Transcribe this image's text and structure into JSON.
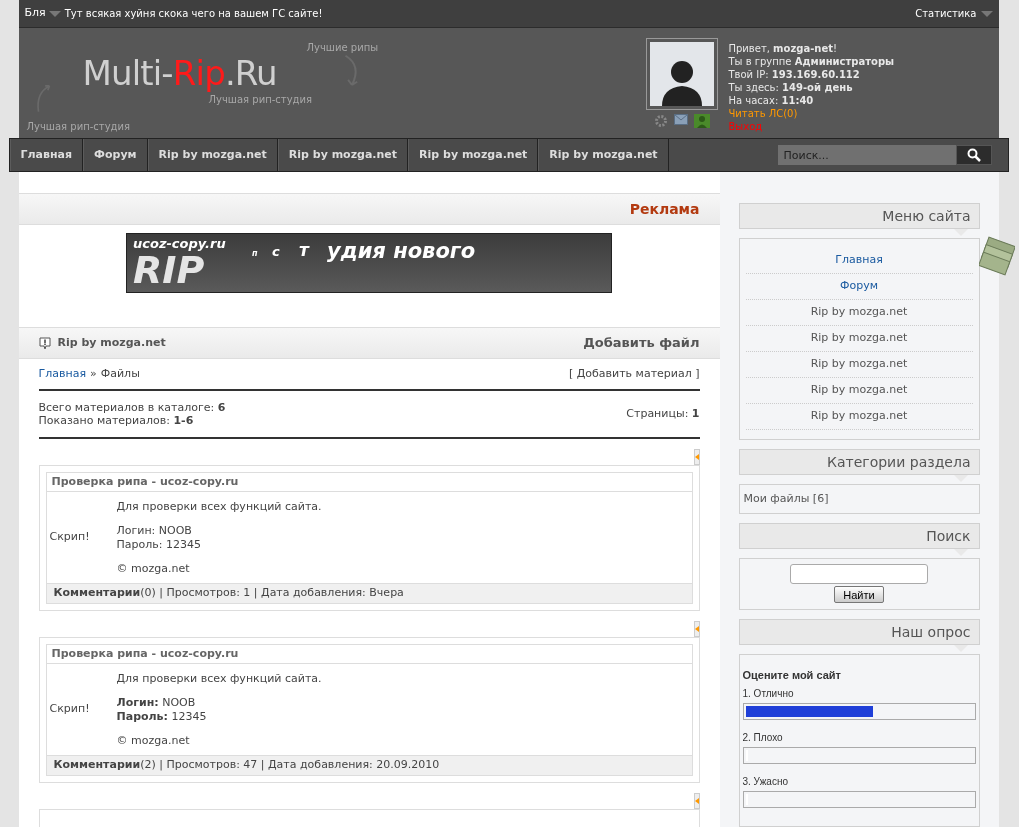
{
  "top_bar": {
    "menu_label": "Бля",
    "ticker": "Тут всякая хуйня скока чего на вашем ГС сайте!",
    "stats_label": "Статистика"
  },
  "header": {
    "logo": {
      "part_1": "Multi-",
      "part_2": "Rip",
      "part_3": ".Ru"
    },
    "slogan": "Лучшая рип-студия",
    "note_top": "Лучшие рипы",
    "note_left": "Лучшая рип-студия",
    "user_lines": [
      "Привет, **mozga-net**!",
      "Ты в группе **Администраторы**",
      "Твой IP: **193.169.60.112**",
      "Ты здесь: **149-ой день**",
      "На часах: **11:40**"
    ],
    "links": [
      {
        "label": "Читать ЛС(0)",
        "color": "#ff9900"
      },
      {
        "label": "Выход",
        "color": "#ff0000"
      }
    ]
  },
  "nav": {
    "items": [
      "Главная",
      "Форум",
      "Rip by mozga.net",
      "Rip by mozga.net",
      "Rip by mozga.net",
      "Rip by mozga.net"
    ],
    "search": {
      "placeholder": "Поиск..."
    }
  },
  "ad": {
    "title": "Реклама",
    "banner": [
      "ucoz-copy.ru",
      "RIP",
      "п",
      "с",
      "т",
      "удия нового"
    ]
  },
  "section": {
    "title": "Rip by mozga.net",
    "action": "Добавить файл",
    "breadcrumb": {
      "home": "Главная",
      "separator": "»",
      "current": "Файлы"
    },
    "add_material": "[ Добавить материал ]",
    "stats": [
      "Всего материалов в каталоге: **6**",
      "Показано материалов: **1-6**"
    ],
    "pages": "Страницы: **1**"
  },
  "posts": [
    {
      "title": "Проверка рипа - ucoz-copy.ru",
      "side": "Скрип!",
      "lines": [
        "Для проверки всех функций сайта.",
        "Логин: NOOB",
        "Пароль: 12345",
        "© mozga.net"
      ],
      "footer": "**Комментарии**(0) | Просмотров: 1 | Дата добавления: Вчера"
    },
    {
      "title": "Проверка рипа - ucoz-copy.ru",
      "side": "Скрип!",
      "lines": [
        "Для проверки всех функций сайта.",
        "**Логин:** NOOB",
        "**Пароль:** 12345",
        "© mozga.net"
      ],
      "footer": "**Комментарии**(2) | Просмотров: 47 | Дата добавления: 20.09.2010"
    }
  ],
  "sidebar": {
    "menu": {
      "title": "Меню сайта",
      "items": [
        {
          "label": "Главная",
          "kind": "link"
        },
        {
          "label": "Форум",
          "kind": "link"
        },
        {
          "label": "Rip by mozga.net",
          "kind": "text"
        },
        {
          "label": "Rip by mozga.net",
          "kind": "text"
        },
        {
          "label": "Rip by mozga.net",
          "kind": "text"
        },
        {
          "label": "Rip by mozga.net",
          "kind": "text"
        },
        {
          "label": "Rip by mozga.net",
          "kind": "text"
        }
      ]
    },
    "categories": {
      "title": "Категории раздела",
      "items": [
        "Мои файлы [6]"
      ]
    },
    "search": {
      "title": "Поиск",
      "button": "Найти"
    },
    "poll": {
      "title": "Наш опрос",
      "question": "Оцените мой сайт",
      "options": [
        {
          "label": "1. Отлично",
          "level": 0.56
        },
        {
          "label": "2. Плохо",
          "level": 0
        },
        {
          "label": "3. Ужасно",
          "level": 0
        }
      ]
    }
  }
}
